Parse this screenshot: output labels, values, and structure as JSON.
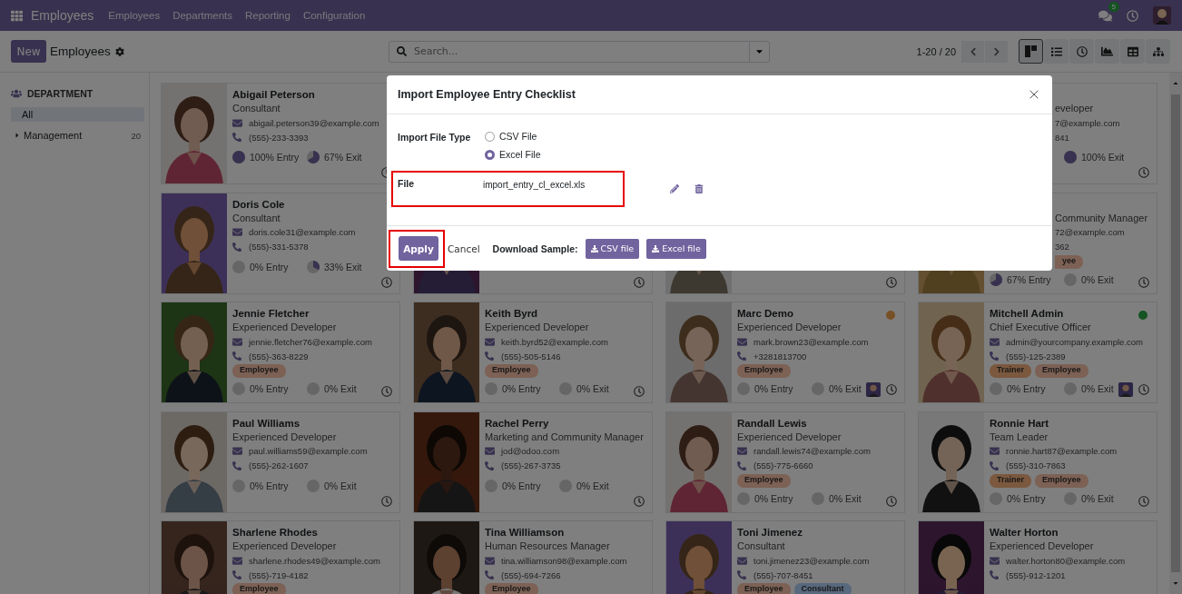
{
  "navbar": {
    "app": "Employees",
    "menus": [
      "Employees",
      "Departments",
      "Reporting",
      "Configuration"
    ],
    "chat_badge": "5"
  },
  "control_panel": {
    "new_button": "New",
    "title": "Employees",
    "search": {
      "placeholder": "Search..."
    },
    "pager": "1-20 / 20",
    "views": [
      {
        "kind": "kanban",
        "selected": true
      },
      {
        "kind": "list",
        "selected": false
      },
      {
        "kind": "activity",
        "selected": false
      },
      {
        "kind": "graph",
        "selected": false
      },
      {
        "kind": "pivot",
        "selected": false
      },
      {
        "kind": "hierarchy",
        "selected": false
      }
    ]
  },
  "sidebar": {
    "title": "DEPARTMENT",
    "items": [
      {
        "label": "All",
        "selected": true
      },
      {
        "label": "Management",
        "count": "20",
        "selected": false
      }
    ]
  },
  "cards": [
    {
      "kind": "employee",
      "name": "Abigail Peterson",
      "job": "Consultant",
      "email": "abigail.peterson39@example.com",
      "phone": "(555)-233-3393",
      "manager_avatar": false,
      "stats": {
        "entry": "100% Entry",
        "exit": "67% Exit"
      }
    },
    {
      "kind": "blank"
    },
    {
      "kind": "blank"
    },
    {
      "kind": "fragment",
      "lines": [
        "eveloper",
        "7@example.com",
        "841"
      ],
      "stats": {
        "exit": "100% Exit"
      }
    },
    {
      "kind": "employee",
      "name": "Doris Cole",
      "job": "Consultant",
      "email": "doris.cole31@example.com",
      "phone": "(555)-331-5378",
      "manager_avatar": false,
      "stats": {
        "entry": "0% Entry",
        "exit": "33% Exit"
      }
    },
    {
      "kind": "covered"
    },
    {
      "kind": "covered"
    },
    {
      "kind": "partial",
      "lines": [
        "Community Manager",
        "72@example.com",
        "362"
      ],
      "tags": [
        {
          "label": "yee",
          "color": "#7d6155"
        }
      ],
      "stats": {
        "entry": "67% Entry",
        "exit": "0% Exit"
      }
    },
    {
      "kind": "employee",
      "name": "Jennie Fletcher",
      "job": "Experienced Developer",
      "email": "jennie.fletcher76@example.com",
      "phone": "(555)-363-8229",
      "tags": [
        {
          "label": "Employee",
          "color": "#7d6155"
        }
      ],
      "manager_avatar": false,
      "stats": {
        "entry": "0% Entry",
        "exit": "0% Exit"
      }
    },
    {
      "kind": "employee",
      "name": "Keith Byrd",
      "job": "Experienced Developer",
      "email": "keith.byrd52@example.com",
      "phone": "(555)-505-5146",
      "tags": [
        {
          "label": "Employee",
          "color": "#7d6155"
        }
      ],
      "manager_avatar": false,
      "stats": {
        "entry": "0% Entry",
        "exit": "0% Exit"
      }
    },
    {
      "kind": "employee",
      "name": "Marc Demo",
      "job": "Experienced Developer",
      "email": "mark.brown23@example.com",
      "phone": "+3281813700",
      "tags": [
        {
          "label": "Employee",
          "color": "#7d6155"
        }
      ],
      "color": "#785026",
      "manager_avatar": true,
      "stats": {
        "entry": "0% Entry",
        "exit": "0% Exit"
      }
    },
    {
      "kind": "employee",
      "name": "Mitchell Admin",
      "job": "Chief Executive Officer",
      "email": "admin@yourcompany.example.com",
      "phone": "(555)-125-2389",
      "tags": [
        {
          "label": "Trainer",
          "color": "#7b583e"
        },
        {
          "label": "Employee",
          "color": "#7d6155"
        }
      ],
      "color": "#145422",
      "manager_avatar": true,
      "stats": {
        "entry": "0% Entry",
        "exit": "0% Exit"
      }
    },
    {
      "kind": "employee",
      "name": "Paul Williams",
      "job": "Experienced Developer",
      "email": "paul.williams59@example.com",
      "phone": "(555)-262-1607",
      "manager_avatar": false,
      "stats": {
        "entry": "0% Entry",
        "exit": "0% Exit"
      }
    },
    {
      "kind": "employee",
      "name": "Rachel Perry",
      "job": "Marketing and Community Manager",
      "email": "jod@odoo.com",
      "phone": "(555)-267-3735",
      "manager_avatar": false,
      "stats": {
        "entry": "0% Entry",
        "exit": "0% Exit"
      }
    },
    {
      "kind": "employee",
      "name": "Randall Lewis",
      "job": "Experienced Developer",
      "email": "randall.lewis74@example.com",
      "phone": "(555)-775-6660",
      "tags": [
        {
          "label": "Employee",
          "color": "#7d6155"
        }
      ],
      "manager_avatar": false,
      "stats": {
        "entry": "0% Entry",
        "exit": "0% Exit"
      }
    },
    {
      "kind": "employee",
      "name": "Ronnie Hart",
      "job": "Team Leader",
      "email": "ronnie.hart87@example.com",
      "phone": "(555)-310-7863",
      "tags": [
        {
          "label": "Trainer",
          "color": "#7b583e"
        },
        {
          "label": "Employee",
          "color": "#7d6155"
        }
      ],
      "manager_avatar": false,
      "stats": {
        "entry": "0% Entry",
        "exit": "0% Exit"
      }
    },
    {
      "kind": "employee",
      "name": "Sharlene Rhodes",
      "job": "Experienced Developer",
      "email": "sharlene.rhodes49@example.com",
      "phone": "(555)-719-4182",
      "tags": [
        {
          "label": "Employee",
          "color": "#7d6155"
        }
      ]
    },
    {
      "kind": "employee",
      "name": "Tina Williamson",
      "job": "Human Resources Manager",
      "email": "tina.williamson98@example.com",
      "phone": "(555)-694-7266",
      "tags": [
        {
          "label": "Employee",
          "color": "#7d6155"
        }
      ]
    },
    {
      "kind": "employee",
      "name": "Toni Jimenez",
      "job": "Consultant",
      "email": "toni.jimenez23@example.com",
      "phone": "(555)-707-8451",
      "tags": [
        {
          "label": "Employee",
          "color": "#7d6155"
        },
        {
          "label": "Consultant",
          "color": "#58687d"
        }
      ]
    },
    {
      "kind": "employee",
      "name": "Walter Horton",
      "job": "Experienced Developer",
      "email": "walter.horton80@example.com",
      "phone": "(555)-912-1201"
    }
  ],
  "dialog": {
    "title": "Import Employee Entry Checklist",
    "file_type_label": "Import File Type",
    "file_types": [
      {
        "label": "CSV File",
        "selected": false
      },
      {
        "label": "Excel File",
        "selected": true
      }
    ],
    "file_label": "File",
    "file_value": "import_entry_cl_excel.xls",
    "apply": "Apply",
    "cancel": "Cancel",
    "sample_label": "Download Sample:",
    "sample_buttons": [
      "CSV file",
      "Excel file"
    ]
  }
}
